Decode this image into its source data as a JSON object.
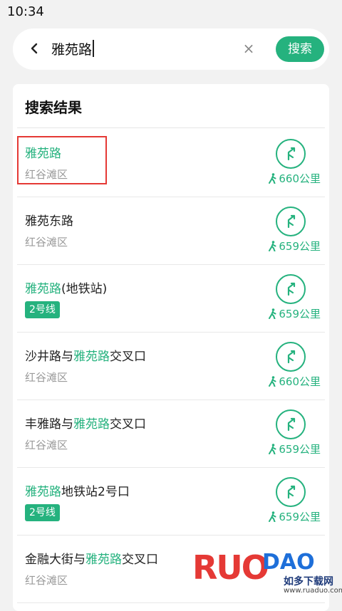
{
  "status_bar": {
    "time": "10:34"
  },
  "search": {
    "query": "雅苑路",
    "clear_icon": "clear-icon",
    "submit_label": "搜索"
  },
  "results": {
    "title": "搜索结果",
    "items": [
      {
        "name_parts": [
          "",
          "雅苑路",
          ""
        ],
        "sub": "红谷滩区",
        "badge": "",
        "distance": "660公里"
      },
      {
        "name_parts": [
          "雅苑东路",
          "",
          ""
        ],
        "sub": "红谷滩区",
        "badge": "",
        "distance": "659公里"
      },
      {
        "name_parts": [
          "",
          "雅苑路",
          "(地铁站)"
        ],
        "sub": "",
        "badge": "2号线",
        "distance": "659公里"
      },
      {
        "name_parts": [
          "沙井路与",
          "雅苑路",
          "交叉口"
        ],
        "sub": "红谷滩区",
        "badge": "",
        "distance": "660公里"
      },
      {
        "name_parts": [
          "丰雅路与",
          "雅苑路",
          "交叉口"
        ],
        "sub": "红谷滩区",
        "badge": "",
        "distance": "659公里"
      },
      {
        "name_parts": [
          "",
          "雅苑路",
          "地铁站2号口"
        ],
        "sub": "",
        "badge": "2号线",
        "distance": "659公里"
      },
      {
        "name_parts": [
          "金融大街与",
          "雅苑路",
          "交叉口"
        ],
        "sub": "红谷滩区",
        "badge": "",
        "distance": ""
      }
    ]
  },
  "watermark": {
    "brand_left": "RUO",
    "brand_right": "DAO",
    "cn": "如多下载网",
    "url": "www.ruaduo.com"
  },
  "colors": {
    "accent": "#25b27e",
    "highlight": "#e53935"
  }
}
